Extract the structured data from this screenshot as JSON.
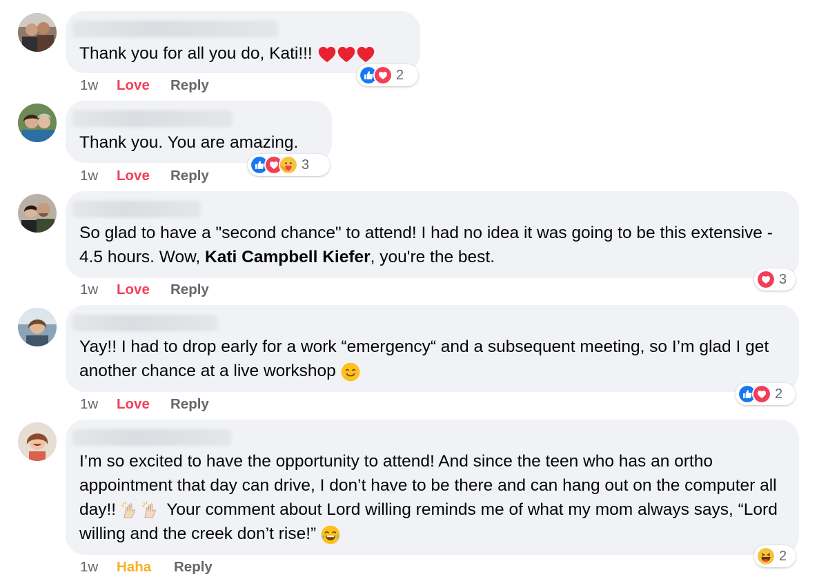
{
  "comments": [
    {
      "text": "Thank you for all you do, Kati!!!",
      "time": "1w",
      "action": "Love",
      "reply": "Reply",
      "reactions": {
        "icons": [
          "like-icon",
          "love-icon"
        ],
        "count": "2"
      }
    },
    {
      "text": "Thank you. You are amazing.",
      "time": "1w",
      "action": "Love",
      "reply": "Reply",
      "reactions": {
        "icons": [
          "like-icon",
          "love-icon",
          "care-icon"
        ],
        "count": "3"
      }
    },
    {
      "text_before": "So glad to have a \"second chance\" to attend! I had no idea it was going to be this extensive - 4.5 hours. Wow, ",
      "mention": "Kati Campbell Kiefer",
      "text_after": ", you're the best.",
      "time": "1w",
      "action": "Love",
      "reply": "Reply",
      "reactions": {
        "icons": [
          "love-icon"
        ],
        "count": "3"
      }
    },
    {
      "text": "Yay!! I had to drop early for a work “emergency“ and a subsequent meeting, so I’m glad I get another chance at a live workshop",
      "time": "1w",
      "action": "Love",
      "reply": "Reply",
      "reactions": {
        "icons": [
          "like-icon",
          "love-icon"
        ],
        "count": "2"
      }
    },
    {
      "text_part1": "I’m so excited to have the opportunity to attend! And since the teen who has an ortho appointment that day can drive, I don’t have to be there and can hang out on the computer all day!!",
      "text_part2": "Your comment about Lord willing reminds me of what my mom always says, “Lord willing and the creek don’t rise!”",
      "time": "1w",
      "action": "Haha",
      "reply": "Reply",
      "reactions": {
        "icons": [
          "haha-icon"
        ],
        "count": "2"
      }
    }
  ],
  "colors": {
    "love": "#f33e58",
    "haha": "#f7b125",
    "like": "#1877f2",
    "bubble": "#f0f2f5",
    "meta": "#65676b"
  }
}
